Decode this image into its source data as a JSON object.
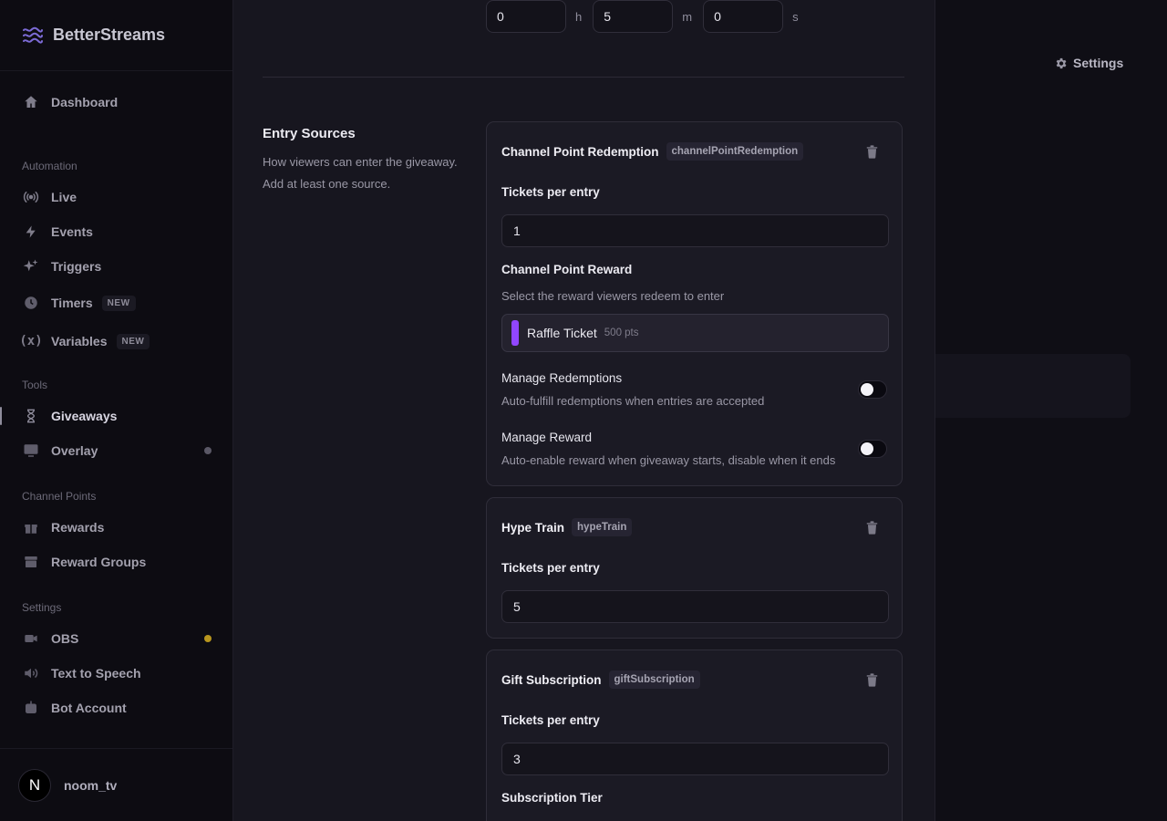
{
  "app": {
    "name": "BetterStreams"
  },
  "header": {
    "settings_label": "Settings"
  },
  "sidebar": {
    "top": [
      {
        "label": "Dashboard",
        "icon": "home-icon"
      }
    ],
    "sections": [
      {
        "title": "Automation",
        "items": [
          {
            "label": "Live",
            "icon": "broadcast-icon"
          },
          {
            "label": "Events",
            "icon": "lightning-icon"
          },
          {
            "label": "Triggers",
            "icon": "sparkles-icon"
          },
          {
            "label": "Timers",
            "icon": "clock-icon",
            "badge": "NEW"
          },
          {
            "label": "Variables",
            "icon": "variable-icon",
            "badge": "NEW"
          }
        ]
      },
      {
        "title": "Tools",
        "items": [
          {
            "label": "Giveaways",
            "icon": "hourglass-icon",
            "active": true
          },
          {
            "label": "Overlay",
            "icon": "monitor-icon",
            "status_color": "#5a5866"
          }
        ]
      },
      {
        "title": "Channel Points",
        "items": [
          {
            "label": "Rewards",
            "icon": "gift-icon"
          },
          {
            "label": "Reward Groups",
            "icon": "archive-icon"
          }
        ]
      },
      {
        "title": "Settings",
        "items": [
          {
            "label": "OBS",
            "icon": "camera-icon",
            "status_color": "#b8961e"
          },
          {
            "label": "Text to Speech",
            "icon": "speaker-icon"
          },
          {
            "label": "Bot Account",
            "icon": "bot-icon"
          }
        ]
      }
    ],
    "user": {
      "initial": "N",
      "name": "noom_tv"
    }
  },
  "duration": {
    "hours": "0",
    "hours_unit": "h",
    "minutes": "5",
    "minutes_unit": "m",
    "seconds": "0",
    "seconds_unit": "s"
  },
  "entry_sources": {
    "title": "Entry Sources",
    "description": "How viewers can enter the giveaway. Add at least one source.",
    "cards": [
      {
        "title": "Channel Point Redemption",
        "tag": "channelPointRedemption",
        "tickets_label": "Tickets per entry",
        "tickets_value": "1",
        "reward_label": "Channel Point Reward",
        "reward_hint": "Select the reward viewers redeem to enter",
        "reward": {
          "name": "Raffle Ticket",
          "cost": "500 pts",
          "color": "#9146ff"
        },
        "toggles": [
          {
            "label": "Manage Redemptions",
            "description": "Auto-fulfill redemptions when entries are accepted",
            "on": false
          },
          {
            "label": "Manage Reward",
            "description": "Auto-enable reward when giveaway starts, disable when it ends",
            "on": false
          }
        ]
      },
      {
        "title": "Hype Train",
        "tag": "hypeTrain",
        "tickets_label": "Tickets per entry",
        "tickets_value": "5"
      },
      {
        "title": "Gift Subscription",
        "tag": "giftSubscription",
        "tickets_label": "Tickets per entry",
        "tickets_value": "3",
        "tier_label": "Subscription Tier"
      }
    ]
  }
}
